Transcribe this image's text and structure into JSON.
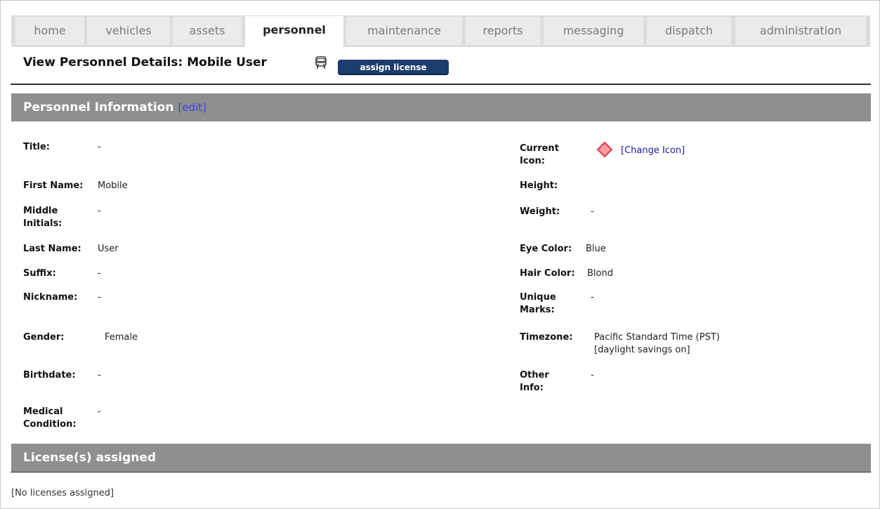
{
  "tabs": [
    {
      "label": "home",
      "active": false
    },
    {
      "label": "vehicles",
      "active": false
    },
    {
      "label": "assets",
      "active": false
    },
    {
      "label": "personnel",
      "active": true
    },
    {
      "label": "maintenance",
      "active": false
    },
    {
      "label": "reports",
      "active": false
    },
    {
      "label": "messaging",
      "active": false
    },
    {
      "label": "dispatch",
      "active": false
    },
    {
      "label": "administration",
      "active": false
    }
  ],
  "page": {
    "title": "View Personnel Details: Mobile User",
    "title_icon": "bus-icon",
    "assign_license_label": "assign license"
  },
  "personnel_section": {
    "header": "Personnel Information",
    "edit_label": "[edit]"
  },
  "fields_left": {
    "title": {
      "label": "Title:",
      "value": "-"
    },
    "first_name": {
      "label": "First Name:",
      "value": "Mobile"
    },
    "middle_initials": {
      "label": "Middle\nInitials:",
      "value": "-"
    },
    "last_name": {
      "label": "Last Name:",
      "value": "User"
    },
    "suffix": {
      "label": "Suffix:",
      "value": "-"
    },
    "nickname": {
      "label": "Nickname:",
      "value": "-"
    },
    "gender": {
      "label": "Gender:",
      "value": "Female"
    },
    "birthdate": {
      "label": "Birthdate:",
      "value": "-"
    },
    "medical_condition": {
      "label": "Medical\nCondition:",
      "value": "-"
    }
  },
  "fields_right": {
    "current_icon": {
      "label": "Current\nIcon:",
      "icon": "red-diamond-icon",
      "change_label": "[Change Icon]"
    },
    "height": {
      "label": "Height:",
      "value": ""
    },
    "weight": {
      "label": "Weight:",
      "value": "-"
    },
    "eye_color": {
      "label": "Eye Color:",
      "value": "Blue"
    },
    "hair_color": {
      "label": "Hair Color:",
      "value": "Blond"
    },
    "unique_marks": {
      "label": "Unique\nMarks:",
      "value": "-"
    },
    "timezone": {
      "label": "Timezone:",
      "value": "Pacific Standard Time (PST)\n[daylight savings on]"
    },
    "other_info": {
      "label": "Other\nInfo:",
      "value": "-"
    }
  },
  "license_section": {
    "header": "License(s) assigned",
    "empty_text": "[No licenses assigned]"
  },
  "colors": {
    "section_header_bg": "#8f8f8f",
    "button_bg": "#1c3d6d",
    "link": "#1a1aa6",
    "diamond": "#e03b44"
  }
}
